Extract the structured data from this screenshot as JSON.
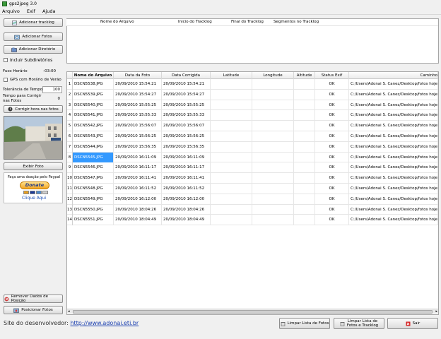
{
  "window": {
    "title": "gps2jpeg 3.0"
  },
  "menu": [
    "Arquivo",
    "Exif",
    "Ajuda"
  ],
  "sidebar": {
    "add_tracklog": "Adicionar tracklog",
    "add_photos": "Adicionar Fotos",
    "add_directory": "Adicionar Diretório",
    "include_subdirs": "Incluir Subdiretórios",
    "timezone_label": "Fuso Horário",
    "timezone_value": "-03:00",
    "dst_label": "GPS com Horário de Verão",
    "tolerance_label": "Tolerância de Tempo",
    "tolerance_value": "100",
    "correct_time_label_1": "Tempo para Corrigir",
    "correct_time_label_2": "nas Fotos",
    "correct_time_value": "0",
    "fix_time_button": "Corrigir hora nas fotos",
    "show_photo": "Exibir Foto",
    "donate_text": "Faça uma doação pelo Paypal",
    "donate_button": "Donate",
    "click_here": "Clique Aqui",
    "remove_position": "Remover Dados de Posição",
    "position_photos": "Posicionar Fotos"
  },
  "tracklog_table": {
    "headers": [
      "Nome do Arquivo",
      "Inicio do Tracklog",
      "Final do Tracklog",
      "Segmentos no Tracklog"
    ]
  },
  "photo_table": {
    "headers": [
      "",
      "Nome do Arquivo",
      "Data da Foto",
      "Data Corrigida",
      "Latitude",
      "Longitude",
      "Altitude",
      "Status Exif",
      "Caminho"
    ],
    "rows": [
      [
        "1",
        "DSCN5538.JPG",
        "20/09/2010 15:54:21",
        "20/09/2010 15:54:21",
        "",
        "",
        "",
        "OK",
        "C:/Users/Adonai S. Canez/Desktop/fotos hoje/D"
      ],
      [
        "2",
        "DSCN5539.JPG",
        "20/09/2010 15:54:27",
        "20/09/2010 15:54:27",
        "",
        "",
        "",
        "OK",
        "C:/Users/Adonai S. Canez/Desktop/fotos hoje/D"
      ],
      [
        "3",
        "DSCN5540.JPG",
        "20/09/2010 15:55:25",
        "20/09/2010 15:55:25",
        "",
        "",
        "",
        "OK",
        "C:/Users/Adonai S. Canez/Desktop/fotos hoje/D"
      ],
      [
        "4",
        "DSCN5541.JPG",
        "20/09/2010 15:55:33",
        "20/09/2010 15:55:33",
        "",
        "",
        "",
        "OK",
        "C:/Users/Adonai S. Canez/Desktop/fotos hoje/D"
      ],
      [
        "5",
        "DSCN5542.JPG",
        "20/09/2010 15:56:07",
        "20/09/2010 15:56:07",
        "",
        "",
        "",
        "OK",
        "C:/Users/Adonai S. Canez/Desktop/fotos hoje/D"
      ],
      [
        "6",
        "DSCN5543.JPG",
        "20/09/2010 15:56:25",
        "20/09/2010 15:56:25",
        "",
        "",
        "",
        "OK",
        "C:/Users/Adonai S. Canez/Desktop/fotos hoje/D"
      ],
      [
        "7",
        "DSCN5544.JPG",
        "20/09/2010 15:56:35",
        "20/09/2010 15:56:35",
        "",
        "",
        "",
        "OK",
        "C:/Users/Adonai S. Canez/Desktop/fotos hoje/D"
      ],
      [
        "8",
        "DSCN5545.JPG",
        "20/09/2010 16:11:09",
        "20/09/2010 16:11:09",
        "",
        "",
        "",
        "OK",
        "C:/Users/Adonai S. Canez/Desktop/fotos hoje/D"
      ],
      [
        "9",
        "DSCN5546.JPG",
        "20/09/2010 16:11:17",
        "20/09/2010 16:11:17",
        "",
        "",
        "",
        "OK",
        "C:/Users/Adonai S. Canez/Desktop/fotos hoje/D"
      ],
      [
        "10",
        "DSCN5547.JPG",
        "20/09/2010 16:11:41",
        "20/09/2010 16:11:41",
        "",
        "",
        "",
        "OK",
        "C:/Users/Adonai S. Canez/Desktop/fotos hoje/D"
      ],
      [
        "11",
        "DSCN5548.JPG",
        "20/09/2010 16:11:52",
        "20/09/2010 16:11:52",
        "",
        "",
        "",
        "OK",
        "C:/Users/Adonai S. Canez/Desktop/fotos hoje/D"
      ],
      [
        "12",
        "DSCN5549.JPG",
        "20/09/2010 16:12:00",
        "20/09/2010 16:12:00",
        "",
        "",
        "",
        "OK",
        "C:/Users/Adonai S. Canez/Desktop/fotos hoje/D"
      ],
      [
        "13",
        "DSCN5550.JPG",
        "20/09/2010 18:04:26",
        "20/09/2010 18:04:26",
        "",
        "",
        "",
        "OK",
        "C:/Users/Adonai S. Canez/Desktop/fotos hoje/D"
      ],
      [
        "14",
        "DSCN5551.JPG",
        "20/09/2010 18:04:49",
        "20/09/2010 18:04:49",
        "",
        "",
        "",
        "OK",
        "C:/Users/Adonai S. Canez/Desktop/fotos hoje/D"
      ]
    ],
    "selected_row": 8
  },
  "footer": {
    "site_label": "Site do desenvolvedor:",
    "site_url": "http://www.adonai.eti.br",
    "clear_photos": "Limpar Lista de Fotos",
    "clear_all_line1": "Limpar Lista de",
    "clear_all_line2": "Fotos e Tracklog",
    "exit": "Sair"
  },
  "colors": {
    "selection": "#3399ff",
    "link": "#1a3fb0",
    "exit_icon": "#d42020"
  },
  "icons": [
    "app-icon",
    "add-tracklog-icon",
    "add-photos-icon",
    "add-directory-icon",
    "clock-icon",
    "remove-icon",
    "position-icon",
    "clear-icon",
    "exit-icon"
  ]
}
